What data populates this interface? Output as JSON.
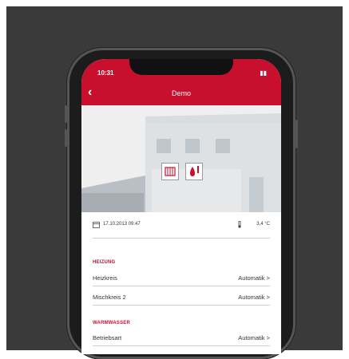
{
  "status_bar": {
    "time": "10:31",
    "indicators": "▮▮"
  },
  "header": {
    "back_glyph": "‹",
    "title": "Demo"
  },
  "info": {
    "date": "17.10.2013 09:47",
    "temperature": "3,4 °C"
  },
  "sections": [
    {
      "title": "HEIZUNG",
      "rows": [
        {
          "label": "Heizkreis",
          "value": "Automatik >"
        },
        {
          "label": "Mischkreis 2",
          "value": "Automatik >"
        }
      ]
    },
    {
      "title": "WARMWASSER",
      "rows": [
        {
          "label": "Betriebsart",
          "value": "Automatik >"
        }
      ]
    }
  ],
  "colors": {
    "brand": "#c8102e",
    "frame": "#3a3a3a",
    "phone": "#1c1c1c"
  },
  "icons": [
    "radiator-icon",
    "hot-water-drop-icon",
    "calendar-icon",
    "outdoor-temperature-icon",
    "back-chevron-icon",
    "signal-icon",
    "battery-icon"
  ]
}
